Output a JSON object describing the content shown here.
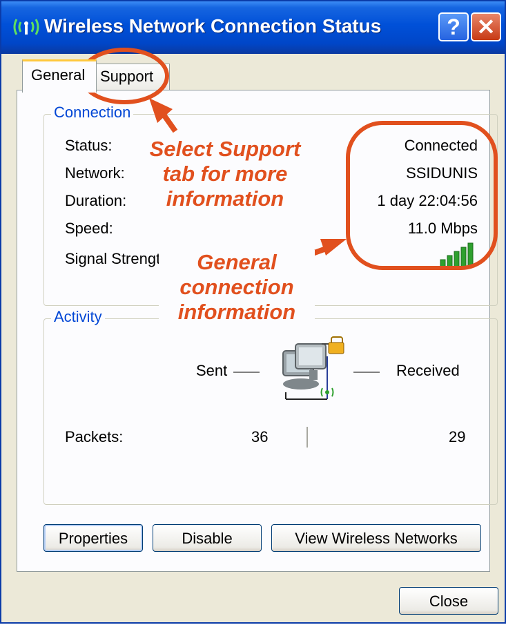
{
  "window": {
    "title": "Wireless Network Connection Status",
    "help_glyph": "?",
    "close_glyph": "✕"
  },
  "tabs": [
    {
      "label": "General",
      "selected": true
    },
    {
      "label": "Support",
      "selected": false
    }
  ],
  "connection": {
    "group_label": "Connection",
    "rows": [
      {
        "label": "Status:",
        "value": "Connected"
      },
      {
        "label": "Network:",
        "value": "SSIDUNIS"
      },
      {
        "label": "Duration:",
        "value": "1 day 22:04:56"
      },
      {
        "label": "Speed:",
        "value": "11.0 Mbps"
      }
    ],
    "signal_label": "Signal Strength",
    "signal_bars": 5
  },
  "activity": {
    "group_label": "Activity",
    "sent_label": "Sent",
    "received_label": "Received",
    "packets_label": "Packets:",
    "packets_sent": "36",
    "packets_received": "29"
  },
  "buttons": {
    "properties": "Properties",
    "disable": "Disable",
    "view_wireless": "View Wireless Networks",
    "close": "Close"
  },
  "annotations": {
    "support_note": [
      "Select Support",
      "tab  for more",
      "information"
    ],
    "general_note": [
      "General",
      "connection",
      "information"
    ]
  },
  "colors": {
    "annotation": "#e1501e",
    "group_label": "#0046d5",
    "signal": "#2ea02e"
  }
}
